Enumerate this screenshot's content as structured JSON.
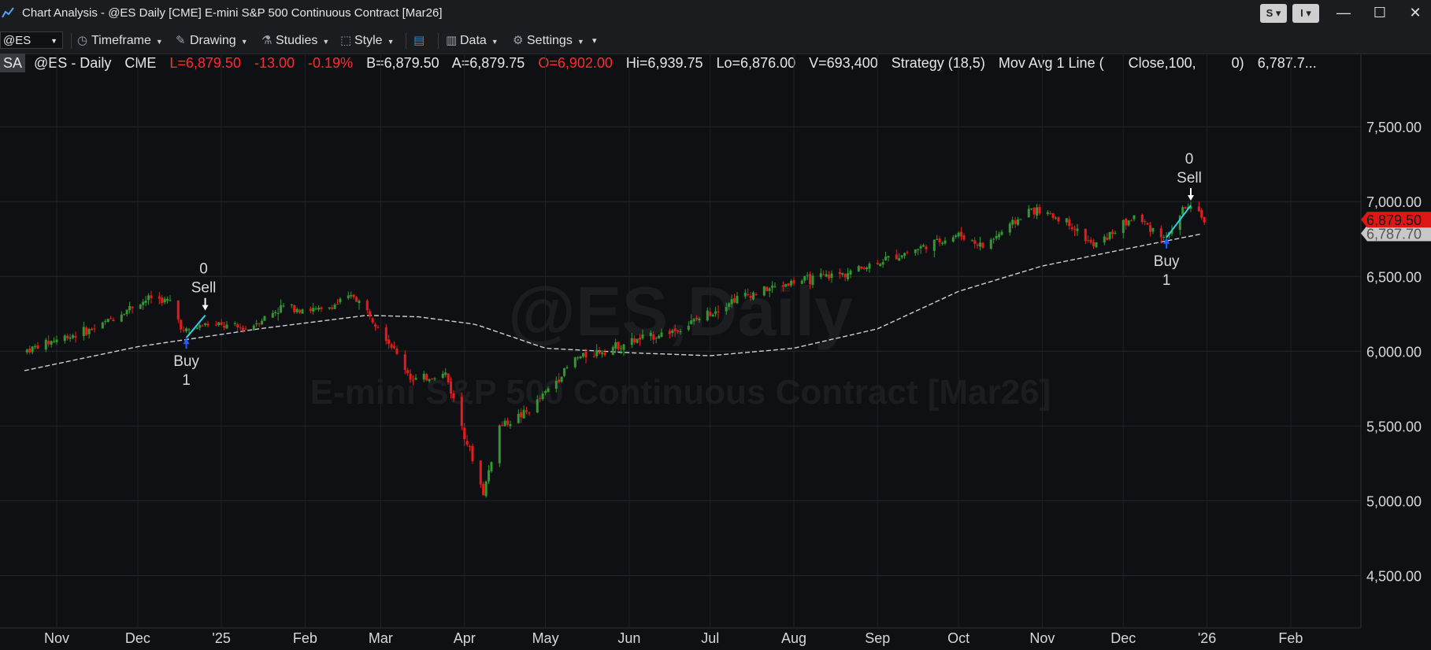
{
  "window": {
    "title": "Chart Analysis - @ES Daily [CME] E-mini S&P 500 Continuous Contract [Mar26]",
    "btn_s": "S",
    "btn_i": "I",
    "minimize": "—",
    "maximize": "☐",
    "close": "✕"
  },
  "toolbar": {
    "symbol": "@ES",
    "timeframe": "Timeframe",
    "drawing": "Drawing",
    "studies": "Studies",
    "style": "Style",
    "data": "Data",
    "settings": "Settings"
  },
  "info": {
    "badge": "SA",
    "symbol_interval": "@ES - Daily",
    "exchange": "CME",
    "last": "L=6,879.50",
    "change": "-13.00",
    "change_pct": "-0.19%",
    "bid": "B=6,879.50",
    "ask": "A=6,879.75",
    "open": "O=6,902.00",
    "high": "Hi=6,939.75",
    "low": "Lo=6,876.00",
    "volume": "V=693,400",
    "strategy": "Strategy (18,5)",
    "study": "Mov Avg 1 Line (",
    "study_params": "Close,100,",
    "study_offset": "0)",
    "study_value": "6,787.7..."
  },
  "watermark": {
    "symbol": "@ES,Daily",
    "description": "E-mini S&P 500 Continuous Contract [Mar26]"
  },
  "colors": {
    "up": "#2f9a2f",
    "down": "#e81b1b",
    "ma_line": "#cfcfcf",
    "trade_line": "#21d4e8",
    "buy_marker": "#1f5bff",
    "last_price_bg": "#e01515",
    "ma_value_bg": "#c8c8c8"
  },
  "chart_data": {
    "type": "candlestick",
    "y_ticks": [
      "7,500.00",
      "7,000.00",
      "6,500.00",
      "6,000.00",
      "5,500.00",
      "5,000.00",
      "4,500.00"
    ],
    "y_tick_values": [
      7500,
      7000,
      6500,
      6000,
      5500,
      5000,
      4500
    ],
    "ylim": [
      4150,
      7990
    ],
    "x_ticks": [
      "Nov",
      "Dec",
      "'25",
      "Feb",
      "Mar",
      "Apr",
      "May",
      "Jun",
      "Jul",
      "Aug",
      "Sep",
      "Oct",
      "Nov",
      "Dec",
      "'26",
      "Feb"
    ],
    "last_price_label": "6,879.50",
    "ma_value_label": "6,787.70",
    "approx_close_path": [
      [
        "2024-10-20",
        6000
      ],
      [
        "2024-11-01",
        6080
      ],
      [
        "2024-11-15",
        6150
      ],
      [
        "2024-11-29",
        6300
      ],
      [
        "2024-12-06",
        6360
      ],
      [
        "2024-12-13",
        6330
      ],
      [
        "2024-12-18",
        6130
      ],
      [
        "2024-12-26",
        6180
      ],
      [
        "2025-01-10",
        6150
      ],
      [
        "2025-01-24",
        6300
      ],
      [
        "2025-02-07",
        6270
      ],
      [
        "2025-02-19",
        6370
      ],
      [
        "2025-02-28",
        6180
      ],
      [
        "2025-03-13",
        5800
      ],
      [
        "2025-03-25",
        5850
      ],
      [
        "2025-04-08",
        5050
      ],
      [
        "2025-04-14",
        5500
      ],
      [
        "2025-04-25",
        5600
      ],
      [
        "2025-05-12",
        5950
      ],
      [
        "2025-05-30",
        6050
      ],
      [
        "2025-06-20",
        6150
      ],
      [
        "2025-07-10",
        6350
      ],
      [
        "2025-07-31",
        6460
      ],
      [
        "2025-08-20",
        6520
      ],
      [
        "2025-09-10",
        6650
      ],
      [
        "2025-10-01",
        6780
      ],
      [
        "2025-10-10",
        6700
      ],
      [
        "2025-10-28",
        6950
      ],
      [
        "2025-11-10",
        6870
      ],
      [
        "2025-11-20",
        6700
      ],
      [
        "2025-12-05",
        6900
      ],
      [
        "2025-12-17",
        6760
      ],
      [
        "2025-12-24",
        6970
      ],
      [
        "2025-12-31",
        6879.5
      ]
    ],
    "moving_average_path": [
      [
        "2024-10-20",
        5870
      ],
      [
        "2024-12-01",
        6030
      ],
      [
        "2025-01-15",
        6150
      ],
      [
        "2025-02-24",
        6240
      ],
      [
        "2025-03-15",
        6230
      ],
      [
        "2025-04-05",
        6180
      ],
      [
        "2025-05-01",
        6020
      ],
      [
        "2025-06-01",
        5990
      ],
      [
        "2025-07-01",
        5970
      ],
      [
        "2025-08-01",
        6020
      ],
      [
        "2025-09-01",
        6150
      ],
      [
        "2025-10-01",
        6400
      ],
      [
        "2025-11-01",
        6570
      ],
      [
        "2025-12-01",
        6680
      ],
      [
        "2025-12-31",
        6787.7
      ]
    ],
    "trades": [
      {
        "type": "Buy",
        "label": "Buy",
        "qty": "1",
        "date": "2024-12-19",
        "price": 6090
      },
      {
        "type": "Sell",
        "label": "Sell",
        "qty": "0",
        "date": "2024-12-26",
        "price": 6240
      },
      {
        "type": "Buy",
        "label": "Buy",
        "qty": "1",
        "date": "2025-12-17",
        "price": 6760
      },
      {
        "type": "Sell",
        "label": "Sell",
        "qty": "0",
        "date": "2025-12-26",
        "price": 6975
      }
    ]
  }
}
